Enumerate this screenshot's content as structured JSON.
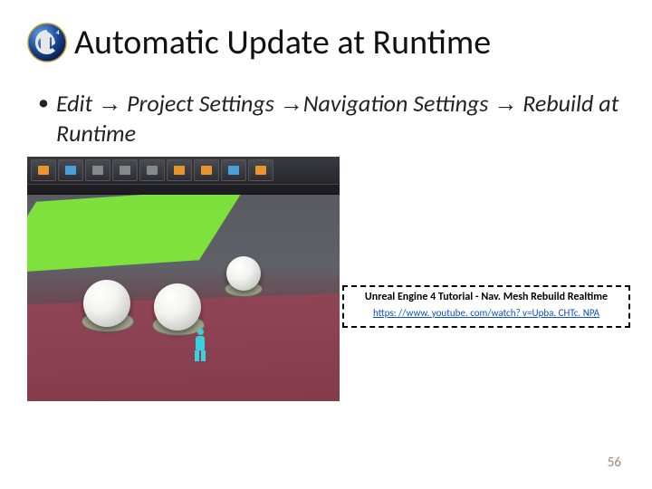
{
  "title": "Automatic Update at Runtime",
  "bullet": {
    "part1": "Edit",
    "part2": "Project Settings",
    "part3": "Navigation Settings",
    "part4": "Rebuild at Runtime"
  },
  "callout": {
    "title": "Unreal Engine 4 Tutorial - Nav. Mesh Rebuild Realtime",
    "link": "https: //www. youtube. com/watch? v=Upba. CHTc. NPA"
  },
  "page_number": "56"
}
